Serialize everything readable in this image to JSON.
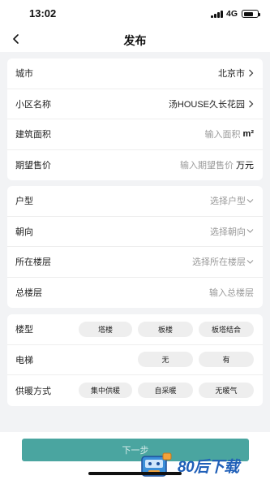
{
  "status_bar": {
    "time": "13:02",
    "network": "4G"
  },
  "nav": {
    "title": "发布"
  },
  "section1": {
    "city": {
      "label": "城市",
      "value": "北京市"
    },
    "community": {
      "label": "小区名称",
      "value": "汤HOUSE久长花园"
    },
    "area": {
      "label": "建筑面积",
      "placeholder": "输入面积",
      "unit": "m²"
    },
    "price": {
      "label": "期望售价",
      "placeholder": "输入期望售价",
      "unit": "万元"
    }
  },
  "section2": {
    "layout": {
      "label": "户型",
      "placeholder": "选择户型"
    },
    "orientation": {
      "label": "朝向",
      "placeholder": "选择朝向"
    },
    "floor": {
      "label": "所在楼层",
      "placeholder": "选择所在楼层"
    },
    "total_floors": {
      "label": "总楼层",
      "placeholder": "输入总楼层"
    }
  },
  "section3": {
    "building_type": {
      "label": "楼型",
      "options": [
        "塔楼",
        "板楼",
        "板塔结合"
      ]
    },
    "elevator": {
      "label": "电梯",
      "options": [
        "无",
        "有"
      ]
    },
    "heating": {
      "label": "供暖方式",
      "options": [
        "集中供暖",
        "自采暖",
        "无暖气"
      ]
    }
  },
  "footer": {
    "next_label": "下一步"
  },
  "watermark": {
    "text": "80后下载"
  }
}
